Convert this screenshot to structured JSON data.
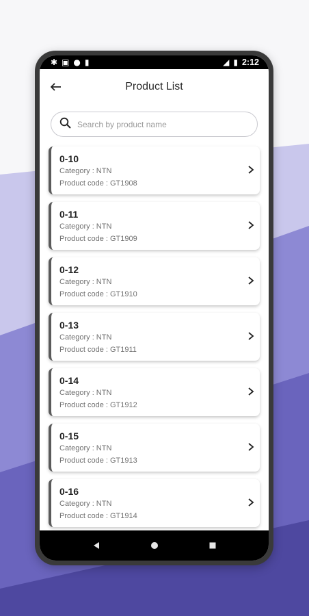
{
  "status_bar": {
    "time": "2:12"
  },
  "app_bar": {
    "title": "Product List"
  },
  "search": {
    "placeholder": "Search by product name"
  },
  "products": [
    {
      "name": "0-10",
      "category": "Category : NTN",
      "code": "Product code : GT1908"
    },
    {
      "name": "0-11",
      "category": "Category : NTN",
      "code": "Product code : GT1909"
    },
    {
      "name": "0-12",
      "category": "Category : NTN",
      "code": "Product code : GT1910"
    },
    {
      "name": "0-13",
      "category": "Category : NTN",
      "code": "Product code : GT1911"
    },
    {
      "name": "0-14",
      "category": "Category : NTN",
      "code": "Product code : GT1912"
    },
    {
      "name": "0-15",
      "category": "Category : NTN",
      "code": "Product code : GT1913"
    },
    {
      "name": "0-16",
      "category": "Category : NTN",
      "code": "Product code : GT1914"
    }
  ],
  "colors": {
    "accent_bar": "#5a5a5a",
    "wave_light": "#c9c7ec",
    "wave_mid": "#8d89d4",
    "wave_dark": "#5650a8"
  }
}
